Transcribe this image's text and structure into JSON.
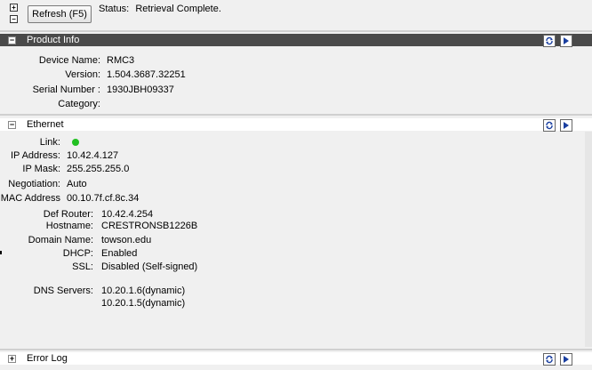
{
  "toolbar": {
    "expand_all_glyph": "+",
    "collapse_all_glyph": "−",
    "refresh_label": "Refresh (F5)",
    "status_label": "Status:",
    "status_value": "Retrieval Complete."
  },
  "product_info": {
    "title": "Product Info",
    "toggle_glyph": "−",
    "fields": [
      {
        "label": "Device Name:",
        "value": "RMC3"
      },
      {
        "label": "Version:",
        "value": "1.504.3687.32251"
      },
      {
        "label": "Serial Number :",
        "value": "1930JBH09337"
      },
      {
        "label": "Category:",
        "value": ""
      }
    ]
  },
  "ethernet": {
    "title": "Ethernet",
    "toggle_glyph": "−",
    "link_label": "Link:",
    "link_status_color": "#22c022",
    "fields_a": [
      {
        "label": "IP Address:",
        "value": "10.42.4.127"
      },
      {
        "label": "IP Mask:",
        "value": "255.255.255.0"
      },
      {
        "label": "Negotiation:",
        "value": "Auto"
      },
      {
        "label": "MAC Address",
        "value": "00.10.7f.cf.8c.34"
      }
    ],
    "fields_b": [
      {
        "label": "Def Router:",
        "value": "10.42.4.254"
      },
      {
        "label": "Hostname:",
        "value": "CRESTRONSB1226B"
      },
      {
        "label": "Domain Name:",
        "value": "towson.edu"
      },
      {
        "label": "DHCP:",
        "value": "Enabled"
      },
      {
        "label": "SSL:",
        "value": "Disabled (Self-signed)"
      }
    ],
    "dns_label": "DNS Servers:",
    "dns_servers": [
      "10.20.1.6(dynamic)",
      "10.20.1.5(dynamic)"
    ]
  },
  "error_log": {
    "title": "Error Log",
    "toggle_glyph": "+"
  },
  "icons": {
    "refresh": "refresh-icon",
    "go": "play-arrow-icon"
  },
  "colors": {
    "header_dark": "#4a4a4a",
    "panel_bg": "#f0f0f0",
    "icon_blue": "#1a3fa0"
  }
}
